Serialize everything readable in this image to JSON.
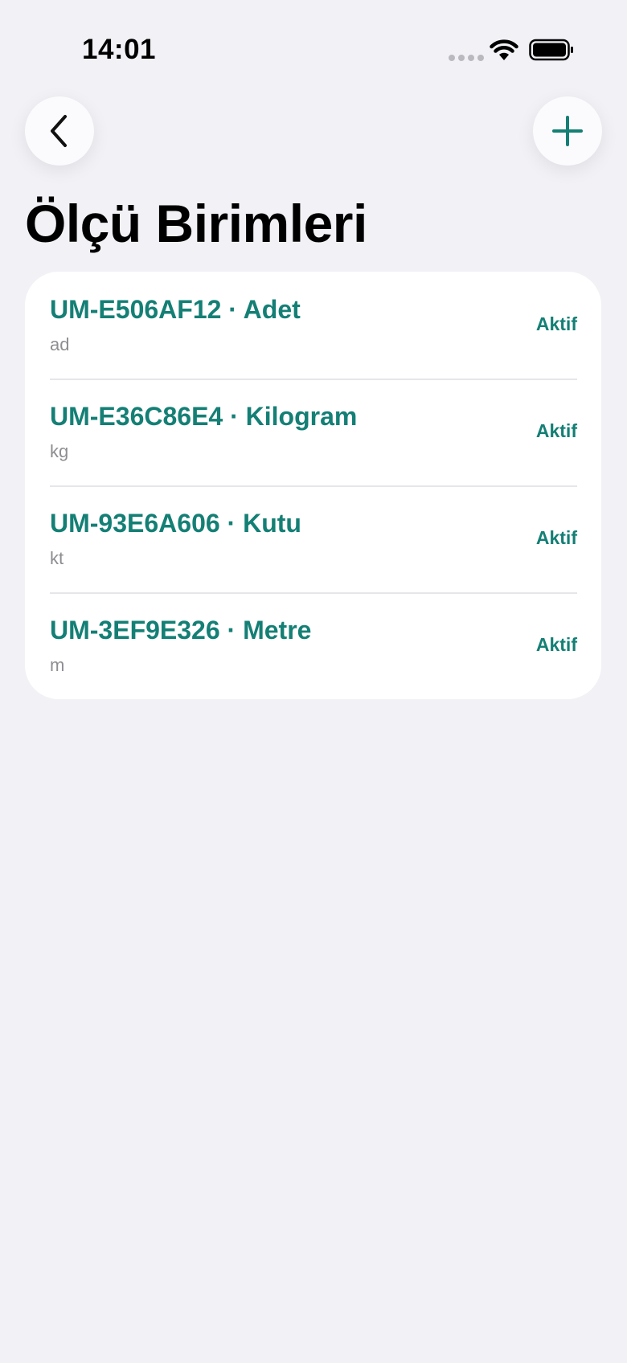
{
  "status_bar": {
    "time": "14:01"
  },
  "header": {
    "back_icon": "chevron-left-icon",
    "add_icon": "plus-icon",
    "accent_color": "#147f75"
  },
  "page": {
    "title": "Ölçü Birimleri"
  },
  "units": [
    {
      "title": "UM-E506AF12 · Adet",
      "abbr": "ad",
      "status": "Aktif"
    },
    {
      "title": "UM-E36C86E4 · Kilogram",
      "abbr": "kg",
      "status": "Aktif"
    },
    {
      "title": "UM-93E6A606 · Kutu",
      "abbr": "kt",
      "status": "Aktif"
    },
    {
      "title": "UM-3EF9E326 · Metre",
      "abbr": "m",
      "status": "Aktif"
    }
  ]
}
